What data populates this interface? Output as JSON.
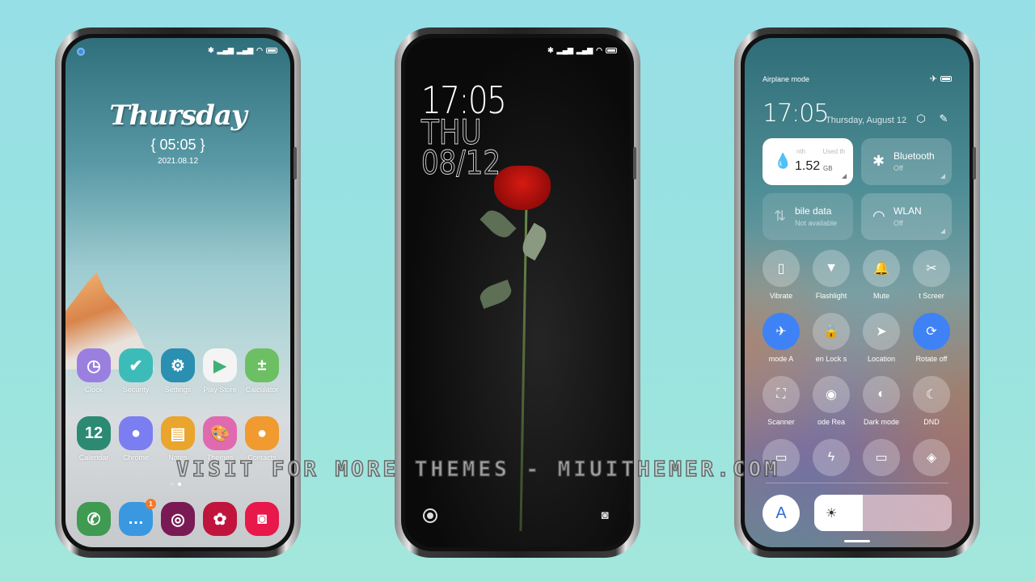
{
  "home": {
    "status_icons": [
      "bluetooth-icon",
      "signal-icon",
      "signal-icon",
      "wifi-icon",
      "battery-icon"
    ],
    "widget": {
      "day": "Thursday",
      "time": "{ 05:05 }",
      "date": "2021.08.12"
    },
    "row1": [
      {
        "label": "Clock",
        "icon": "clock-icon",
        "color": "#9b7fe0",
        "glyph": "◷"
      },
      {
        "label": "Security",
        "icon": "shield-icon",
        "color": "#3cbcb8",
        "glyph": "✔"
      },
      {
        "label": "Settings",
        "icon": "gear-icon",
        "color": "#2a8fb0",
        "glyph": "⚙"
      },
      {
        "label": "Play Store",
        "icon": "play-store-icon",
        "color": "#f4f4f4",
        "glyph": "▶"
      },
      {
        "label": "Calculator",
        "icon": "calculator-icon",
        "color": "#6cc063",
        "glyph": "±"
      }
    ],
    "row2": [
      {
        "label": "Calendar",
        "icon": "calendar-icon",
        "color": "#2c8a73",
        "glyph": "12"
      },
      {
        "label": "Chrome",
        "icon": "chrome-icon",
        "color": "#7a7ef0",
        "glyph": "●"
      },
      {
        "label": "Notes",
        "icon": "notes-icon",
        "color": "#e9a52c",
        "glyph": "▤"
      },
      {
        "label": "Themes",
        "icon": "themes-icon",
        "color": "#e06ab0",
        "glyph": "🎨"
      },
      {
        "label": "Contacts",
        "icon": "contacts-icon",
        "color": "#f09a30",
        "glyph": "●"
      }
    ],
    "dock": [
      {
        "name": "phone",
        "icon": "phone-icon",
        "color": "#3f9a52",
        "glyph": "✆"
      },
      {
        "name": "messages",
        "icon": "messages-icon",
        "color": "#3a98e0",
        "glyph": "…",
        "badge": "1"
      },
      {
        "name": "fingerprint",
        "icon": "fingerprint-icon",
        "color": "#7a1a55",
        "glyph": "◎"
      },
      {
        "name": "gallery",
        "icon": "gallery-icon",
        "color": "#c0143c",
        "glyph": "✿"
      },
      {
        "name": "camera",
        "icon": "camera-icon",
        "color": "#e8184a",
        "glyph": "◙"
      }
    ]
  },
  "lock": {
    "time": "17:05",
    "day": "THU",
    "date": "08/12",
    "left_shortcut": "assistant-icon",
    "right_shortcut": "camera-icon"
  },
  "control": {
    "mode_label": "Airplane mode",
    "time": "17:05",
    "date": "Thursday, August 12",
    "data_tile": {
      "left": "nth",
      "right": "Used th",
      "value": "1.52",
      "unit": "GB"
    },
    "bluetooth": {
      "title": "Bluetooth",
      "sub": "Off"
    },
    "mobile": {
      "title": "bile data",
      "sub": "Not available"
    },
    "wlan": {
      "title": "WLAN",
      "sub": "Off"
    },
    "row1": [
      {
        "label": "Vibrate",
        "glyph": "▯",
        "icon": "vibrate-icon",
        "on": false
      },
      {
        "label": "Flashlight",
        "glyph": "▼",
        "icon": "flashlight-icon",
        "on": false
      },
      {
        "label": "Mute",
        "glyph": "🔔",
        "icon": "bell-icon",
        "on": false
      },
      {
        "label": "t    Screer",
        "glyph": "✂",
        "icon": "screenshot-icon",
        "on": false
      }
    ],
    "row2": [
      {
        "label": "mode    A",
        "glyph": "✈",
        "icon": "airplane-icon",
        "on": true
      },
      {
        "label": "en    Lock s",
        "glyph": "🔒",
        "icon": "lock-icon",
        "on": false
      },
      {
        "label": "Location",
        "glyph": "➤",
        "icon": "location-icon",
        "on": false
      },
      {
        "label": "Rotate off",
        "glyph": "⟳",
        "icon": "rotate-icon",
        "on": true
      }
    ],
    "row3": [
      {
        "label": "Scanner",
        "glyph": "⛶",
        "icon": "scanner-icon",
        "on": false
      },
      {
        "label": "ode    Rea",
        "glyph": "◉",
        "icon": "eye-icon",
        "on": false
      },
      {
        "label": "Dark mode",
        "glyph": "◐",
        "icon": "dark-mode-icon",
        "on": false
      },
      {
        "label": "DND",
        "glyph": "☾",
        "icon": "moon-icon",
        "on": false
      }
    ],
    "row4": [
      {
        "glyph": "▭",
        "icon": "battery-saver-icon"
      },
      {
        "glyph": "ϟ",
        "icon": "lightning-icon"
      },
      {
        "glyph": "▭",
        "icon": "cast-icon"
      },
      {
        "glyph": "◈",
        "icon": "link-icon"
      }
    ],
    "auto_brightness": "A",
    "brightness_percent": 35
  },
  "watermark": "VISIT FOR MORE THEMES - MIUITHEMER.COM"
}
